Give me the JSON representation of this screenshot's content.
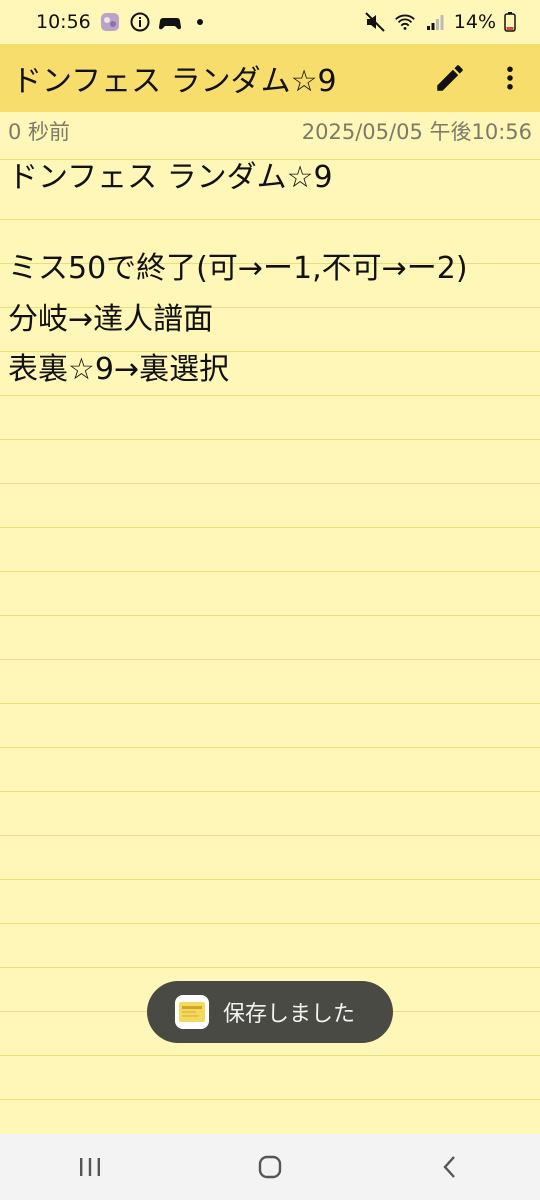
{
  "status_bar": {
    "time": "10:56",
    "battery": "14%"
  },
  "app_bar": {
    "title": "ドンフェス ランダム☆9"
  },
  "meta": {
    "relative_time": "0 秒前",
    "timestamp": "2025/05/05 午後10:56"
  },
  "note": {
    "lines": [
      "ドンフェス ランダム☆9",
      "",
      "ミス50で終了(可→ー1,不可→ー2)",
      "分岐→達人譜面",
      "表裏☆9→裏選択"
    ]
  },
  "toast": {
    "text": "保存しました"
  },
  "colors": {
    "background": "#fff7b8",
    "app_bar": "#f7dd6c",
    "ruled_line": "#eedc78",
    "toast": "#4a4a44"
  }
}
